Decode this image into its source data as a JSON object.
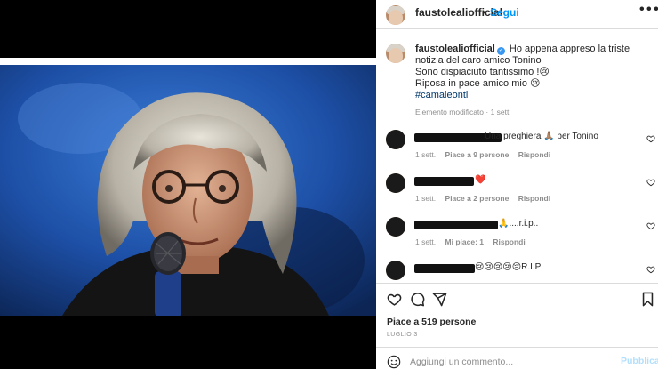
{
  "header": {
    "username": "faustolealiofficial",
    "separator": "•",
    "follow_label": "Segui",
    "more_icon": "ellipsis-icon"
  },
  "caption": {
    "username": "faustolealiofficial",
    "line1": "Ho appena appreso la triste notizia del caro amico Tonino",
    "line2": "Sono dispiaciuto tantissimo !😢",
    "line3": "Riposa in pace amico mio 😢",
    "hashtag": "#camaleonti",
    "meta": "Elemento modificato · 1 sett."
  },
  "comments": [
    {
      "text": "Una preghiera 🙏🏽 per Tonino",
      "time": "1 sett.",
      "likes": "Piace a 9 persone",
      "reply": "Rispondi"
    },
    {
      "text": "❤️",
      "time": "1 sett.",
      "likes": "Piace a 2 persone",
      "reply": "Rispondi"
    },
    {
      "text": "🙏....r.i.p..",
      "time": "1 sett.",
      "likes": "Mi piace: 1",
      "reply": "Rispondi"
    },
    {
      "text": "😢😢😢😢😢R.I.P",
      "time": "",
      "likes": "",
      "reply": ""
    }
  ],
  "post": {
    "likes": "Piace a 519 persone",
    "date": "LUGLIO 3"
  },
  "add_comment": {
    "placeholder": "Aggiungi un commento...",
    "publish_label": "Pubblica"
  },
  "colors": {
    "follow": "#0095f6",
    "publish_disabled": "#b2dffc",
    "muted_text": "#8e8e8e",
    "divider": "#dbdbdb"
  },
  "icons": [
    "like-icon",
    "comment-icon",
    "share-icon",
    "save-icon",
    "emoji-icon",
    "heart-small-icon",
    "verified-badge-icon"
  ]
}
